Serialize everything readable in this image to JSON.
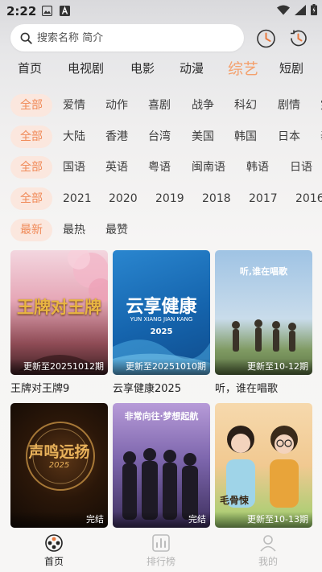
{
  "status_bar": {
    "time": "2:22"
  },
  "search": {
    "placeholder": "搜索名称 简介"
  },
  "category_tabs": [
    {
      "label": "首页"
    },
    {
      "label": "电视剧"
    },
    {
      "label": "电影"
    },
    {
      "label": "动漫"
    },
    {
      "label": "综艺",
      "active": true
    },
    {
      "label": "短剧"
    }
  ],
  "filters": {
    "type": {
      "selected": "全部",
      "options": [
        "爱情",
        "动作",
        "喜剧",
        "战争",
        "科幻",
        "剧情",
        "灾"
      ]
    },
    "region": {
      "selected": "全部",
      "options": [
        "大陆",
        "香港",
        "台湾",
        "美国",
        "韩国",
        "日本",
        "泰"
      ]
    },
    "language": {
      "selected": "全部",
      "options": [
        "国语",
        "英语",
        "粤语",
        "闽南语",
        "韩语",
        "日语"
      ]
    },
    "year": {
      "selected": "全部",
      "options": [
        "2021",
        "2020",
        "2019",
        "2018",
        "2017",
        "2016"
      ]
    },
    "sort": {
      "selected": "最新",
      "options": [
        "最热",
        "最赞"
      ]
    }
  },
  "cards": [
    {
      "title": "王牌对王牌9",
      "badge": "更新至20251012期",
      "art": "王牌对王牌",
      "color_top": "#f1d3dc",
      "color_bottom": "#7d3b48",
      "art_color": "#e8b542"
    },
    {
      "title": "云享健康2025",
      "badge": "更新至20251010期",
      "art": "云享健康",
      "art_sub": "YUN XIANG JIAN KANG",
      "art_year": "2025",
      "color_top": "#1d6db8",
      "color_bottom": "#114d8f",
      "art_color": "#ffffff"
    },
    {
      "title": "听，谁在唱歌",
      "badge": "更新至10-12期",
      "art": "听,谁在唱歌",
      "color_top": "#a9c9e6",
      "color_bottom": "#6e8a5a",
      "art_color": "#ffffff"
    },
    {
      "title": "",
      "badge": "完结",
      "art": "声鸣远扬",
      "art_year": "2025",
      "color_top": "#2b1a10",
      "color_bottom": "#120b06",
      "art_color": "#e9b25a"
    },
    {
      "title": "",
      "badge": "完结",
      "art": "非常向往·梦想起航",
      "color_top": "#8a6fb8",
      "color_bottom": "#3a2d5a",
      "art_color": "#ffffff"
    },
    {
      "title": "",
      "badge": "更新至10-13期",
      "art": "毛骨悚",
      "color_top": "#f3d2a2",
      "color_bottom": "#9ccf6e",
      "art_color": "#3b2a18"
    }
  ],
  "bottom_nav": [
    {
      "label": "首页",
      "icon": "film-reel-icon",
      "active": true
    },
    {
      "label": "排行榜",
      "icon": "chart-icon"
    },
    {
      "label": "我的",
      "icon": "profile-icon"
    }
  ]
}
